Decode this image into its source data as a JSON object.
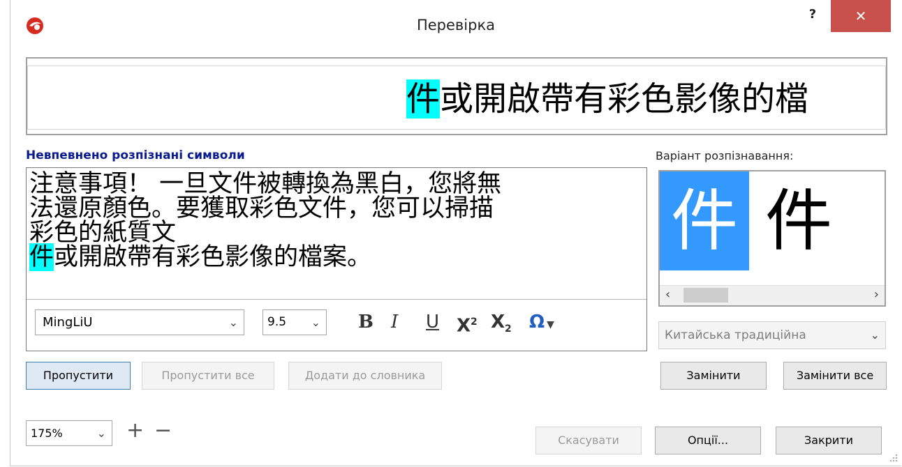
{
  "window": {
    "title": "Перевірка",
    "help_label": "?",
    "close_label": "✕"
  },
  "preview": {
    "highlight": "件",
    "rest": "或開啟帶有彩色影像的檔"
  },
  "labels": {
    "uncertain_chars": "Невпевнено розпізнані символи",
    "variant": "Варіант розпізнавання:"
  },
  "editor": {
    "line1": "注意事項！ 一旦文件被轉換為黑白，您將無",
    "line2": "法還原顏色。要獲取彩色文件，您可以掃描",
    "line3": "彩色的紙質文",
    "line4_highlight": "件",
    "line4_rest": "或開啟帶有彩色影像的檔案。"
  },
  "toolbar": {
    "font": "MingLiU",
    "size": "9.5",
    "bold": "B",
    "italic": "I",
    "underline": "U",
    "superscript": "X",
    "superscript_mark": "2",
    "subscript": "X",
    "subscript_mark": "2",
    "special": "Ω"
  },
  "variant": {
    "selected": "件",
    "alternative": "件",
    "language": "Китайська традиційна"
  },
  "buttons": {
    "skip": "Пропустити",
    "skip_all": "Пропустити все",
    "add_dictionary": "Додати до словника",
    "replace": "Замінити",
    "replace_all": "Замінити все",
    "cancel": "Скасувати",
    "options": "Опції...",
    "close": "Закрити"
  },
  "zoom": {
    "value": "175%",
    "plus": "+",
    "minus": "−"
  },
  "colors": {
    "highlight": "#00ffff",
    "selection": "#3399ff",
    "close_button": "#c7504a",
    "label_blue": "#0a1a8f"
  }
}
